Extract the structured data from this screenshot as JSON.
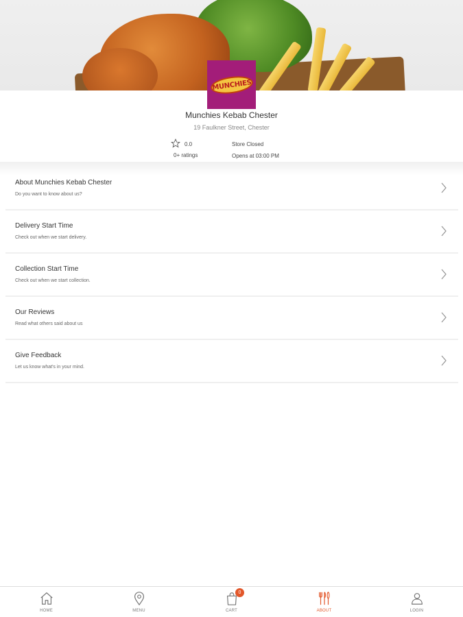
{
  "store": {
    "name": "Munchies Kebab Chester",
    "address": "19 Faulkner Street, Chester",
    "logo_text": "MUNCHIES",
    "rating_value": "0.0",
    "rating_count": "0+ ratings",
    "status": "Store Closed",
    "opens": "Opens at 03:00 PM"
  },
  "colors": {
    "accent": "#e2572a",
    "logo_bg": "#a31d79"
  },
  "menu_items": [
    {
      "title": "About Munchies Kebab Chester",
      "subtitle": "Do you want to know about us?",
      "icon": "chevron-right-icon"
    },
    {
      "title": "Delivery Start Time",
      "subtitle": "Check out when we start delivery.",
      "icon": "chevron-right-icon"
    },
    {
      "title": "Collection Start Time",
      "subtitle": "Check out when we start collection.",
      "icon": "chevron-right-icon"
    },
    {
      "title": "Our Reviews",
      "subtitle": "Read what others said about us",
      "icon": "chevron-right-icon"
    },
    {
      "title": "Give Feedback",
      "subtitle": "Let us know what's in your mind.",
      "icon": "chevron-right-icon"
    }
  ],
  "tabs": [
    {
      "label": "HOME",
      "icon": "home-icon"
    },
    {
      "label": "MENU",
      "icon": "location-pin-icon"
    },
    {
      "label": "CART",
      "icon": "shopping-bag-icon",
      "badge": "0"
    },
    {
      "label": "ABOUT",
      "icon": "fork-knife-icon",
      "active": true
    },
    {
      "label": "LOGIN",
      "icon": "user-icon"
    }
  ]
}
